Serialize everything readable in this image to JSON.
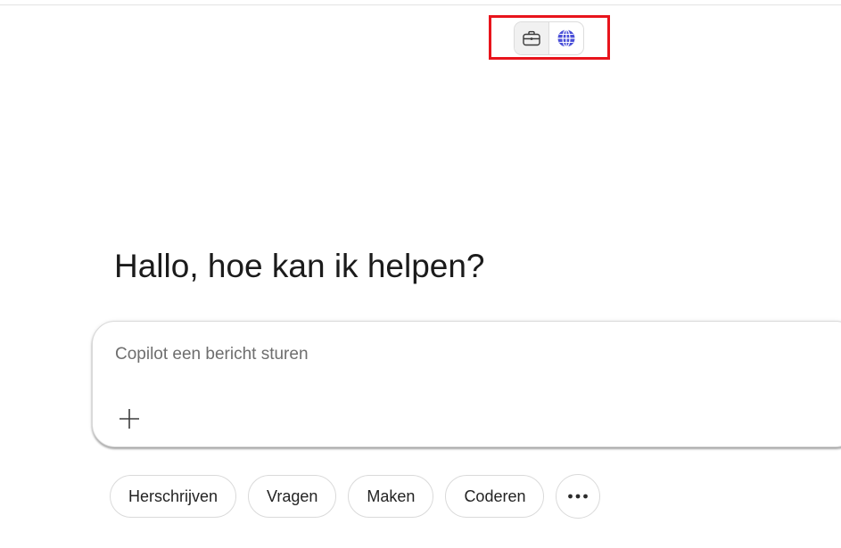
{
  "header": {
    "mode_toggle": [
      {
        "name": "work",
        "icon": "briefcase-icon",
        "selected": true
      },
      {
        "name": "web",
        "icon": "globe-icon",
        "selected": false
      }
    ]
  },
  "main": {
    "greeting": "Hallo, hoe kan ik helpen?"
  },
  "composer": {
    "placeholder": "Copilot een bericht sturen",
    "add_icon": "plus-icon"
  },
  "chips": [
    {
      "label": "Herschrijven"
    },
    {
      "label": "Vragen"
    },
    {
      "label": "Maken"
    },
    {
      "label": "Coderen"
    },
    {
      "label": "",
      "icon": "more-dots-icon"
    }
  ],
  "colors": {
    "highlight": "#e8141c",
    "globe": "#4a4fd8"
  }
}
